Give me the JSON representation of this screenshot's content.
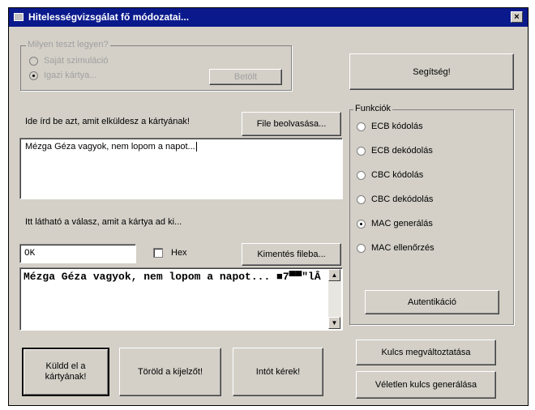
{
  "window": {
    "title": "Hitelességvizsgálat fő módozatai...",
    "close_label": "×"
  },
  "mode_group": {
    "legend": "Milyen teszt legyen?",
    "option1": "Saját szimuláció",
    "option2": "Igazi kártya...",
    "option2_selected": true,
    "browse_label": "Betölt"
  },
  "help_button": "Segítség!",
  "input_section": {
    "label": "Ide írd be azt, amit elküldesz a kártyának!",
    "load_button": "File beolvasása...",
    "text": "Mézga Géza vagyok, nem lopom a napot..."
  },
  "response_section": {
    "label": "Itt látható a válasz, amit a kártya ad ki...",
    "status_value": "OK",
    "hex_label": "Hex",
    "hex_checked": false,
    "save_button": "Kimentés fileba...",
    "response_text": "Mézga Géza vagyok, nem lopom a napot... ■7▀▀\"lÂ"
  },
  "functions": {
    "legend": "Funkciók",
    "items": [
      {
        "label": "ECB kódolás",
        "selected": false
      },
      {
        "label": "ECB dekódolás",
        "selected": false
      },
      {
        "label": "CBC kódolás",
        "selected": false
      },
      {
        "label": "CBC dekódolás",
        "selected": false
      },
      {
        "label": "MAC generálás",
        "selected": true
      },
      {
        "label": "MAC ellenőrzés",
        "selected": false
      }
    ],
    "auth_button": "Autentikáció"
  },
  "bottom_buttons": {
    "send": "Küldd el a kártyának!",
    "clear": "Töröld a kijelzőt!",
    "random": "Intót kérek!"
  },
  "key_buttons": {
    "change_key": "Kulcs megváltoztatása",
    "random_key": "Véletlen kulcs generálása"
  }
}
